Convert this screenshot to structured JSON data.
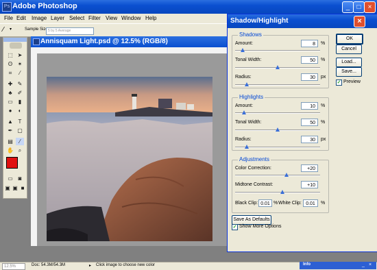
{
  "app": {
    "title": "Adobe Photoshop"
  },
  "menu": [
    "File",
    "Edit",
    "Image",
    "Layer",
    "Select",
    "Filter",
    "View",
    "Window",
    "Help"
  ],
  "options": {
    "sample_size_label": "Sample Size:",
    "sample_size_value": "5 by 5 Average"
  },
  "document": {
    "title": "Annisquam Light.psd @ 12.5% (RGB/8)"
  },
  "dialog": {
    "title": "Shadow/Highlight",
    "shadows": {
      "label": "Shadows",
      "amount": {
        "label": "Amount:",
        "value": "8",
        "unit": "%",
        "level": 0.08
      },
      "tonal_width": {
        "label": "Tonal Width:",
        "value": "50",
        "unit": "%",
        "level": 0.5
      },
      "radius": {
        "label": "Radius:",
        "value": "30",
        "unit": "px",
        "level": 0.12
      }
    },
    "highlights": {
      "label": "Highlights",
      "amount": {
        "label": "Amount:",
        "value": "10",
        "unit": "%",
        "level": 0.1
      },
      "tonal_width": {
        "label": "Tonal Width:",
        "value": "50",
        "unit": "%",
        "level": 0.5
      },
      "radius": {
        "label": "Radius:",
        "value": "30",
        "unit": "px",
        "level": 0.12
      }
    },
    "adjustments": {
      "label": "Adjustments",
      "color_correction": {
        "label": "Color Correction:",
        "value": "+20",
        "level": 0.6
      },
      "midtone_contrast": {
        "label": "Midtone Contrast:",
        "value": "+10",
        "level": 0.55
      },
      "black_clip": {
        "label": "Black Clip:",
        "value": "0.01",
        "unit": "%"
      },
      "white_clip": {
        "label": "White Clip:",
        "value": "0.01",
        "unit": "%"
      }
    },
    "buttons": {
      "ok": "OK",
      "cancel": "Cancel",
      "load": "Load...",
      "save": "Save...",
      "save_defaults": "Save As Defaults"
    },
    "preview_label": "Preview",
    "show_more_label": "Show More Options"
  },
  "status": {
    "zoom": "12.5%",
    "doc_size": "Doc: 54.3M/54.3M",
    "tip": "Click image to choose new color"
  },
  "info_panel": {
    "label": "Info"
  },
  "colors": {
    "foreground": "#e01010",
    "background": "#ffffff",
    "title_blue": "#0a4fd0"
  }
}
